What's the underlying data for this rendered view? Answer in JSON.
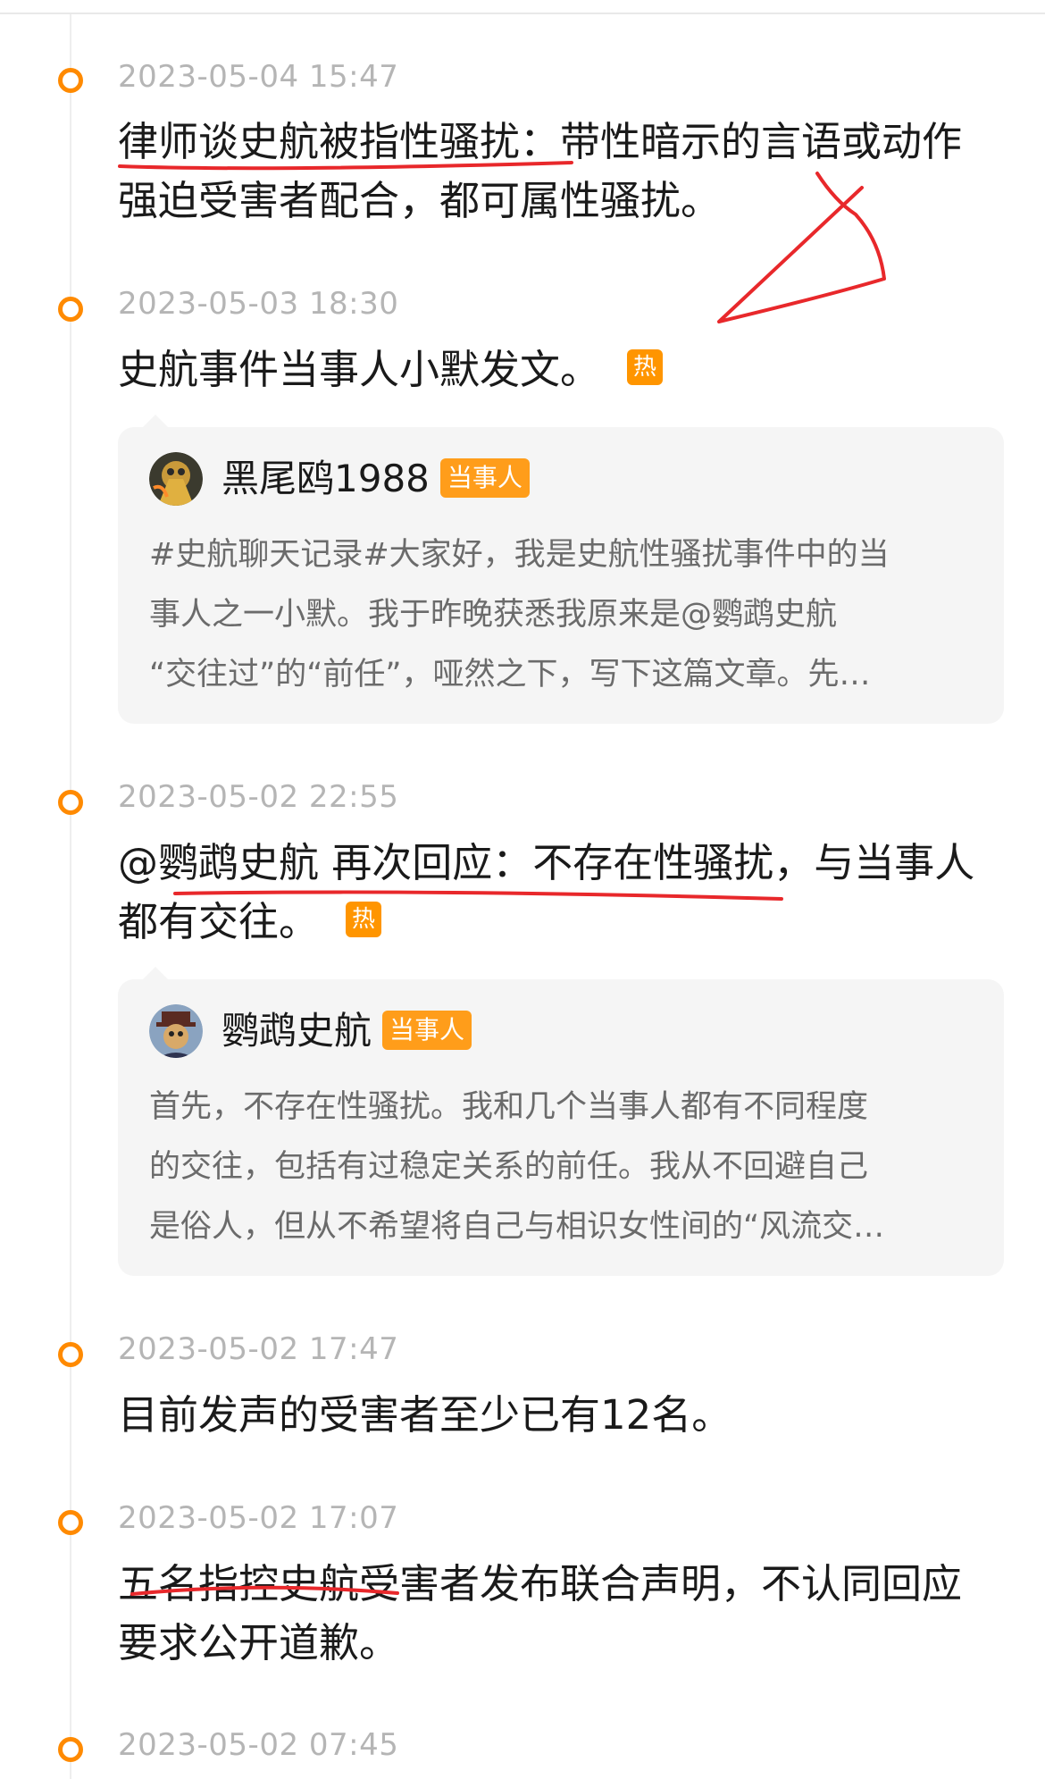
{
  "timeline": [
    {
      "time": "2023-05-04 15:47",
      "headline": "律师谈史航被指性骚扰：带性暗示的言语或动作强迫受害者配合，都可属性骚扰。",
      "headline_lines": [
        "律师谈史航被指性骚扰：带性暗示的言语或动作",
        "强迫受害者配合，都可属性骚扰。"
      ]
    },
    {
      "time": "2023-05-03 18:30",
      "headline": "史航事件当事人小默发文。",
      "hot_badge": "热",
      "card": {
        "author": "黑尾鸥1988",
        "role_badge": "当事人",
        "body_lines": [
          "#史航聊天记录#大家好，我是史航性骚扰事件中的当",
          "事人之一小默。我于昨晚获悉我原来是@鹦鹉史航",
          "“交往过”的“前任”，哑然之下，写下这篇文章。先…"
        ]
      }
    },
    {
      "time": "2023-05-02 22:55",
      "headline_lines": [
        "@鹦鹉史航 再次回应：不存在性骚扰，与当事人",
        "都有交往。"
      ],
      "hot_badge": "热",
      "card": {
        "author": "鹦鹉史航",
        "role_badge": "当事人",
        "body_lines": [
          "首先，不存在性骚扰。我和几个当事人都有不同程度",
          "的交往，包括有过稳定关系的前任。我从不回避自己",
          "是俗人，但从不希望将自己与相识女性间的“风流交…"
        ]
      }
    },
    {
      "time": "2023-05-02 17:47",
      "headline": "目前发声的受害者至少已有12名。"
    },
    {
      "time": "2023-05-02 17:07",
      "headline_lines": [
        "五名指控史航受害者发布联合声明，不认同回应",
        "要求公开道歉。"
      ]
    },
    {
      "time": "2023-05-02 07:45"
    }
  ],
  "colors": {
    "accent": "#ff8a00",
    "badge": "#ff9500",
    "annotation_red": "#e8282b",
    "time_gray": "#b5b5b5"
  },
  "icons": {
    "timeline_dot": "timeline-dot-icon",
    "avatar_1": "avatar-bird-artwork",
    "avatar_2": "avatar-parrot-hat"
  }
}
